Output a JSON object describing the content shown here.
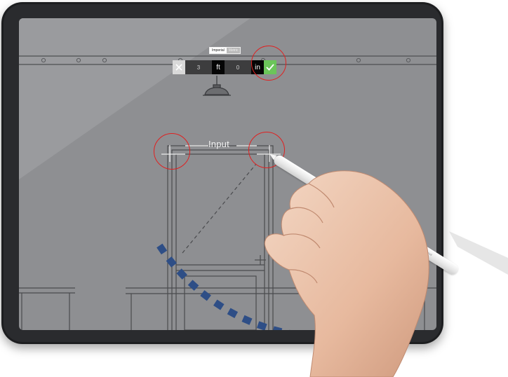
{
  "unit_system": {
    "options": [
      "Imperial",
      "Metric"
    ],
    "selected": "Imperial"
  },
  "input_bar": {
    "feet_value": "3",
    "feet_unit": "ft",
    "inch_value": "0",
    "inch_unit": "in"
  },
  "canvas_label": "Input",
  "pencil_brand": "Pencil",
  "colors": {
    "accent_green": "#6bc55a",
    "highlight_red": "#e02020",
    "arc_blue": "#2e4e86"
  }
}
